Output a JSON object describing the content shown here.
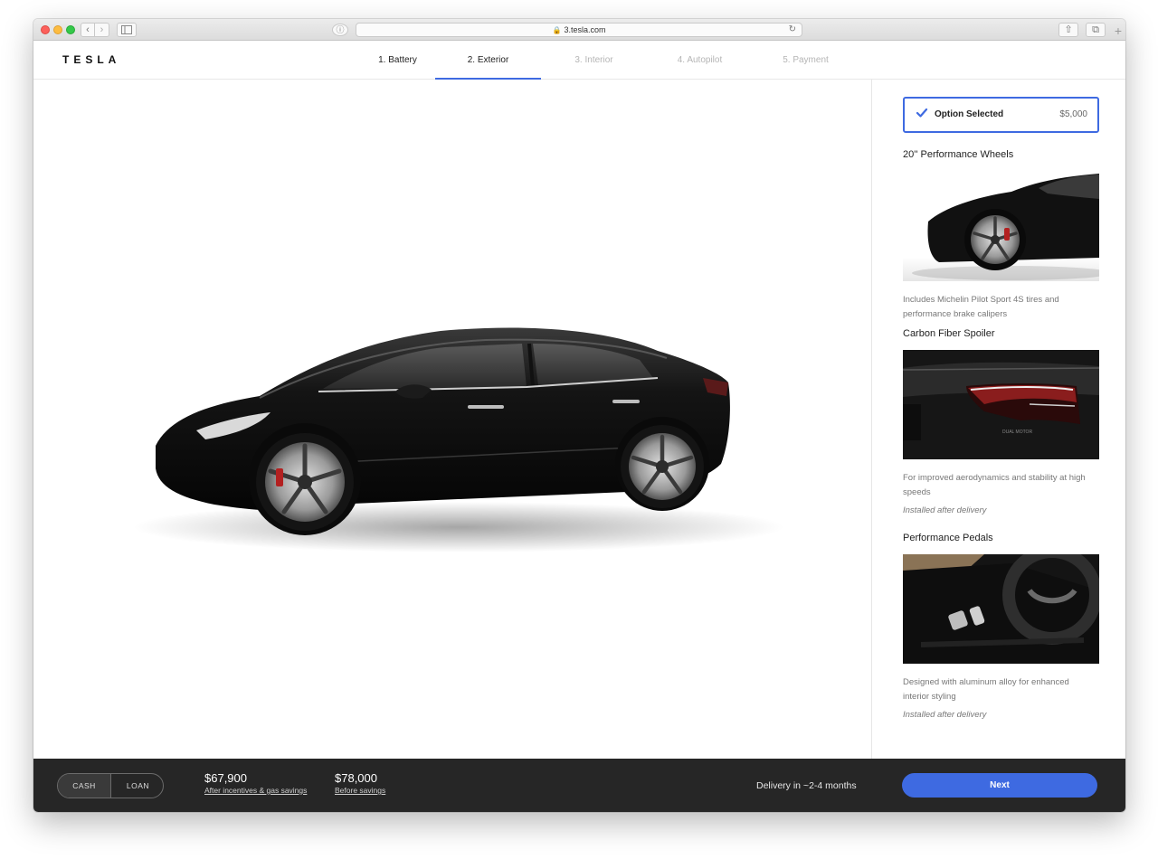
{
  "browser": {
    "url": "3.tesla.com",
    "icons": [
      "back-icon",
      "forward-icon",
      "sidebar-icon",
      "shield-icon",
      "lock-icon",
      "reload-icon",
      "share-icon",
      "tabs-icon",
      "new-tab-icon"
    ]
  },
  "header": {
    "logo": "TESLA",
    "steps": [
      {
        "label": "1. Battery",
        "state": "done"
      },
      {
        "label": "2. Exterior",
        "state": "active"
      },
      {
        "label": "3. Interior",
        "state": "upcoming"
      },
      {
        "label": "4. Autopilot",
        "state": "upcoming"
      },
      {
        "label": "5. Payment",
        "state": "upcoming"
      }
    ]
  },
  "option": {
    "label": "Option Selected",
    "price": "$5,000",
    "checked": true
  },
  "features": [
    {
      "title": "20'' Performance Wheels",
      "description": "Includes Michelin Pilot Sport 4S tires and performance brake calipers",
      "note": ""
    },
    {
      "title": "Carbon Fiber Spoiler",
      "description": "For improved aerodynamics and stability at high speeds",
      "note": "Installed after delivery"
    },
    {
      "title": "Performance Pedals",
      "description": "Designed with aluminum alloy for enhanced interior styling",
      "note": "Installed after delivery"
    }
  ],
  "footer": {
    "payment_options": [
      "CASH",
      "LOAN"
    ],
    "selected_payment": "CASH",
    "price_after": "$67,900",
    "price_after_label": "After incentives & gas savings",
    "price_before": "$78,000",
    "price_before_label": "Before savings",
    "delivery": "Delivery in ~2-4 months",
    "next_label": "Next"
  },
  "colors": {
    "accent": "#3e6ae1",
    "footer_bg": "#262626",
    "car_paint": "#111111"
  }
}
